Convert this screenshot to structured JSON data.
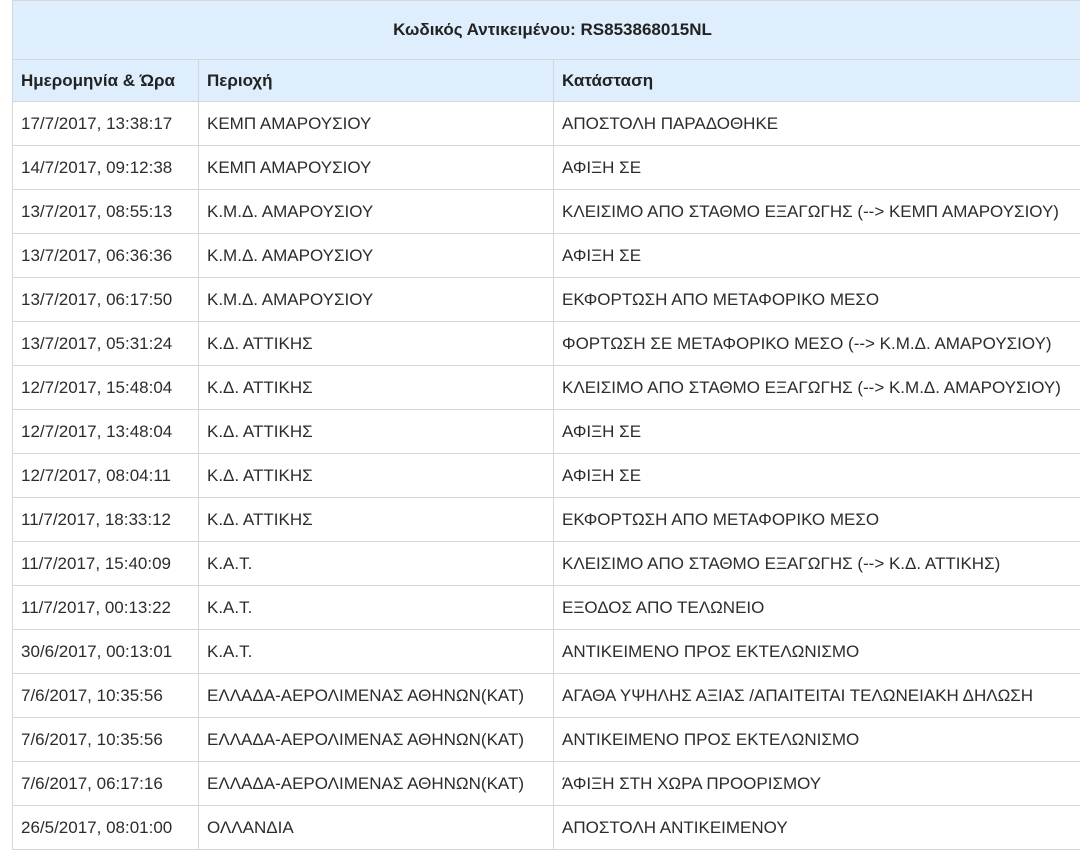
{
  "header": {
    "title": "Κωδικός Αντικειμένου: RS853868015NL"
  },
  "columns": [
    "Ημερομηνία & Ώρα",
    "Περιοχή",
    "Κατάσταση"
  ],
  "rows": [
    [
      "17/7/2017, 13:38:17",
      "ΚΕΜΠ ΑΜΑΡΟΥΣΙΟΥ",
      "ΑΠΟΣΤΟΛΗ ΠΑΡΑΔΟΘΗΚΕ"
    ],
    [
      "14/7/2017, 09:12:38",
      "ΚΕΜΠ ΑΜΑΡΟΥΣΙΟΥ",
      "ΑΦΙΞΗ ΣΕ"
    ],
    [
      "13/7/2017, 08:55:13",
      "Κ.Μ.Δ. ΑΜΑΡΟΥΣΙΟΥ",
      "ΚΛΕΙΣΙΜΟ ΑΠΟ ΣΤΑΘΜΟ ΕΞΑΓΩΓΗΣ (--> ΚΕΜΠ ΑΜΑΡΟΥΣΙΟΥ)"
    ],
    [
      "13/7/2017, 06:36:36",
      "Κ.Μ.Δ. ΑΜΑΡΟΥΣΙΟΥ",
      "ΑΦΙΞΗ ΣΕ"
    ],
    [
      "13/7/2017, 06:17:50",
      "Κ.Μ.Δ. ΑΜΑΡΟΥΣΙΟΥ",
      "ΕΚΦΟΡΤΩΣΗ ΑΠΟ ΜΕΤΑΦΟΡΙΚΟ ΜΕΣΟ"
    ],
    [
      "13/7/2017, 05:31:24",
      "Κ.Δ. ΑΤΤΙΚΗΣ",
      "ΦΟΡΤΩΣΗ ΣΕ ΜΕΤΑΦΟΡΙΚΟ ΜΕΣΟ (--> Κ.Μ.Δ. ΑΜΑΡΟΥΣΙΟΥ)"
    ],
    [
      "12/7/2017, 15:48:04",
      "Κ.Δ. ΑΤΤΙΚΗΣ",
      "ΚΛΕΙΣΙΜΟ ΑΠΟ ΣΤΑΘΜΟ ΕΞΑΓΩΓΗΣ (--> Κ.Μ.Δ. ΑΜΑΡΟΥΣΙΟΥ)"
    ],
    [
      "12/7/2017, 13:48:04",
      "Κ.Δ. ΑΤΤΙΚΗΣ",
      "ΑΦΙΞΗ ΣΕ"
    ],
    [
      "12/7/2017, 08:04:11",
      "Κ.Δ. ΑΤΤΙΚΗΣ",
      "ΑΦΙΞΗ ΣΕ"
    ],
    [
      "11/7/2017, 18:33:12",
      "Κ.Δ. ΑΤΤΙΚΗΣ",
      "ΕΚΦΟΡΤΩΣΗ ΑΠΟ ΜΕΤΑΦΟΡΙΚΟ ΜΕΣΟ"
    ],
    [
      "11/7/2017, 15:40:09",
      "Κ.Α.Τ.",
      "ΚΛΕΙΣΙΜΟ ΑΠΟ ΣΤΑΘΜΟ ΕΞΑΓΩΓΗΣ (--> Κ.Δ. ΑΤΤΙΚΗΣ)"
    ],
    [
      "11/7/2017, 00:13:22",
      "Κ.Α.Τ.",
      "ΕΞΟΔΟΣ ΑΠΟ ΤΕΛΩΝΕΙΟ"
    ],
    [
      "30/6/2017, 00:13:01",
      "Κ.Α.Τ.",
      "ΑΝΤΙΚΕΙΜΕΝΟ ΠΡΟΣ ΕΚΤΕΛΩΝΙΣΜΟ"
    ],
    [
      "7/6/2017, 10:35:56",
      "ΕΛΛΑΔΑ-ΑΕΡΟΛΙΜΕΝΑΣ ΑΘΗΝΩΝ(ΚΑΤ)",
      "ΑΓΑΘΑ ΥΨΗΛΗΣ ΑΞΙΑΣ /ΑΠΑΙΤΕΙΤΑΙ ΤΕΛΩΝΕΙΑΚΗ ΔΗΛΩΣΗ"
    ],
    [
      "7/6/2017, 10:35:56",
      "ΕΛΛΑΔΑ-ΑΕΡΟΛΙΜΕΝΑΣ ΑΘΗΝΩΝ(ΚΑΤ)",
      "ΑΝΤΙΚΕΙΜΕΝΟ ΠΡΟΣ ΕΚΤΕΛΩΝΙΣΜΟ"
    ],
    [
      "7/6/2017, 06:17:16",
      "ΕΛΛΑΔΑ-ΑΕΡΟΛΙΜΕΝΑΣ ΑΘΗΝΩΝ(ΚΑΤ)",
      "ΆΦΙΞΗ ΣΤΗ ΧΩΡΑ ΠΡΟΟΡΙΣΜΟΥ"
    ],
    [
      "26/5/2017, 08:01:00",
      "ΟΛΛΑΝΔΙΑ",
      "ΑΠΟΣΤΟΛΗ ΑΝΤΙΚΕΙΜΕΝΟΥ"
    ]
  ],
  "colors": {
    "header_bg": "#dfeefd",
    "border": "#d6d6d6"
  }
}
